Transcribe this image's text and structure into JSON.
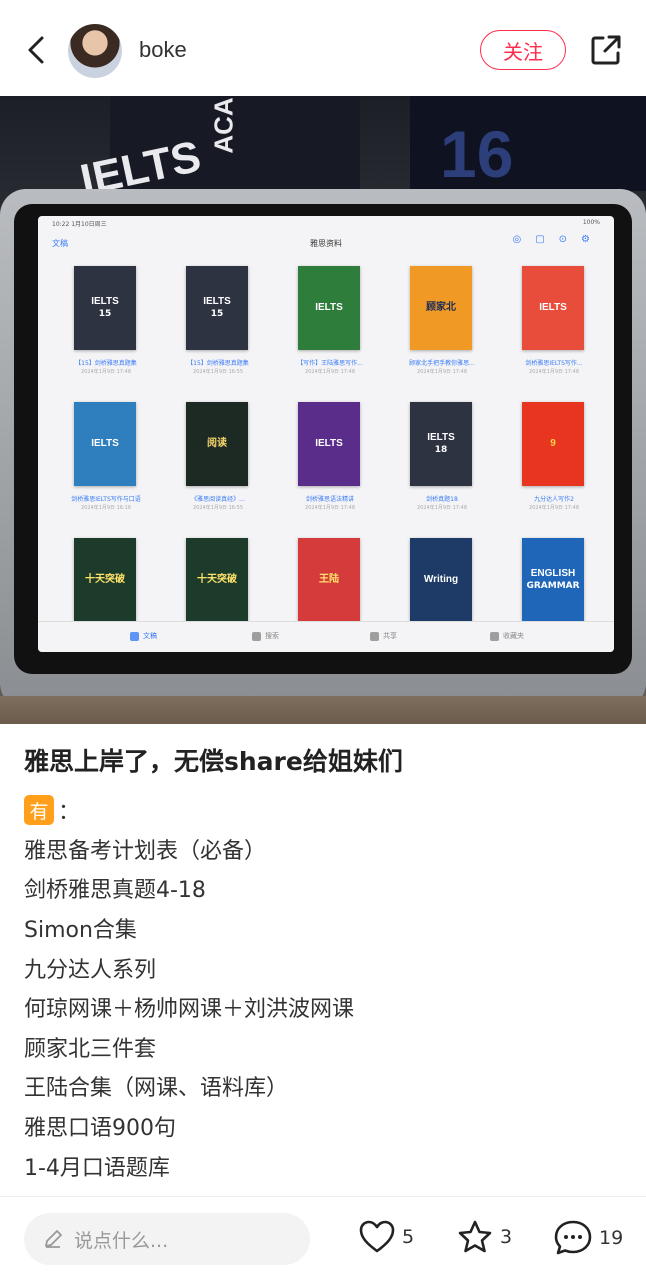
{
  "header": {
    "username": "boke",
    "follow_label": "关注"
  },
  "photo": {
    "bg_texts": [
      "IELTS",
      "ACA",
      "16"
    ],
    "tablet": {
      "status_time": "10:22  1月10日周三",
      "status_right": "100%",
      "nav_back": "文稿",
      "nav_title": "雅思资料",
      "books": [
        {
          "title": "IELTS",
          "sub": "15",
          "bg": "#2d3340",
          "fg": "#ffffff",
          "caption": "【15】剑桥雅思真题集",
          "date": "2024年1月9日 17:48"
        },
        {
          "title": "IELTS",
          "sub": "15",
          "bg": "#2d3340",
          "fg": "#ffffff",
          "caption": "【15】剑桥雅思真题集",
          "date": "2024年1月9日 16:55"
        },
        {
          "title": "IELTS",
          "sub": "",
          "bg": "#2f7d3a",
          "fg": "#ffffff",
          "caption": "【写作】王陆雅思写作...",
          "date": "2024年1月9日 17:48"
        },
        {
          "title": "顾家北",
          "sub": "",
          "bg": "#f09a25",
          "fg": "#1b2b5a",
          "caption": "顾家北手把手教你雅思...",
          "date": "2024年1月9日 17:48"
        },
        {
          "title": "IELTS",
          "sub": "",
          "bg": "#e84c3b",
          "fg": "#ffffff",
          "caption": "剑桥雅思IELTS写作...",
          "date": "2024年1月9日 17:48"
        },
        {
          "title": "IELTS",
          "sub": "",
          "bg": "#2f7fbf",
          "fg": "#ffffff",
          "caption": "剑桥雅思IELTS写作与口语",
          "date": "2024年1月9日 16:16"
        },
        {
          "title": "阅读",
          "sub": "",
          "bg": "#1d2a23",
          "fg": "#f3d36b",
          "caption": "《雅思阅读真经》...",
          "date": "2024年1月9日 16:55"
        },
        {
          "title": "IELTS",
          "sub": "",
          "bg": "#5b2d8a",
          "fg": "#ffffff",
          "caption": "剑桥雅思语法精讲",
          "date": "2024年1月9日 17:48"
        },
        {
          "title": "IELTS",
          "sub": "18",
          "bg": "#2d3340",
          "fg": "#ffffff",
          "caption": "剑桥真题18",
          "date": "2024年1月9日 17:48"
        },
        {
          "title": "9",
          "sub": "",
          "bg": "#e8351f",
          "fg": "#f7d54a",
          "caption": "九分达人写作2",
          "date": "2024年1月9日 17:48"
        },
        {
          "title": "十天突破",
          "sub": "",
          "bg": "#1d3b2a",
          "fg": "#ffe36b",
          "caption": "",
          "date": ""
        },
        {
          "title": "十天突破",
          "sub": "",
          "bg": "#1d3b2a",
          "fg": "#ffe36b",
          "caption": "",
          "date": ""
        },
        {
          "title": "王陆",
          "sub": "",
          "bg": "#d63b3b",
          "fg": "#ffe36b",
          "caption": "",
          "date": ""
        },
        {
          "title": "Writing",
          "sub": "",
          "bg": "#1d3b66",
          "fg": "#ffffff",
          "caption": "",
          "date": ""
        },
        {
          "title": "ENGLISH",
          "sub": "GRAMMAR",
          "bg": "#1f66b8",
          "fg": "#ffffff",
          "caption": "",
          "date": ""
        }
      ],
      "tabs": [
        "文稿",
        "搜索",
        "共享",
        "收藏夹"
      ]
    }
  },
  "post": {
    "title": "雅思上岸了，无偿share给姐妹们",
    "badge": "有",
    "badge_suffix": "：",
    "lines": [
      "雅思备考计划表（必备）",
      "剑桥雅思真题4-18",
      "Simon合集",
      "九分达人系列",
      "何琼网课＋杨帅网课＋刘洪波网课",
      "顾家北三件套",
      "王陆合集（网课、语料库）",
      "雅思口语900句",
      "1-4月口语题库"
    ]
  },
  "bottom": {
    "comment_placeholder": "说点什么...",
    "likes": "5",
    "stars": "3",
    "comments": "19"
  },
  "colors": {
    "accent": "#ff2e4d",
    "badge": "#ff9f1c"
  }
}
